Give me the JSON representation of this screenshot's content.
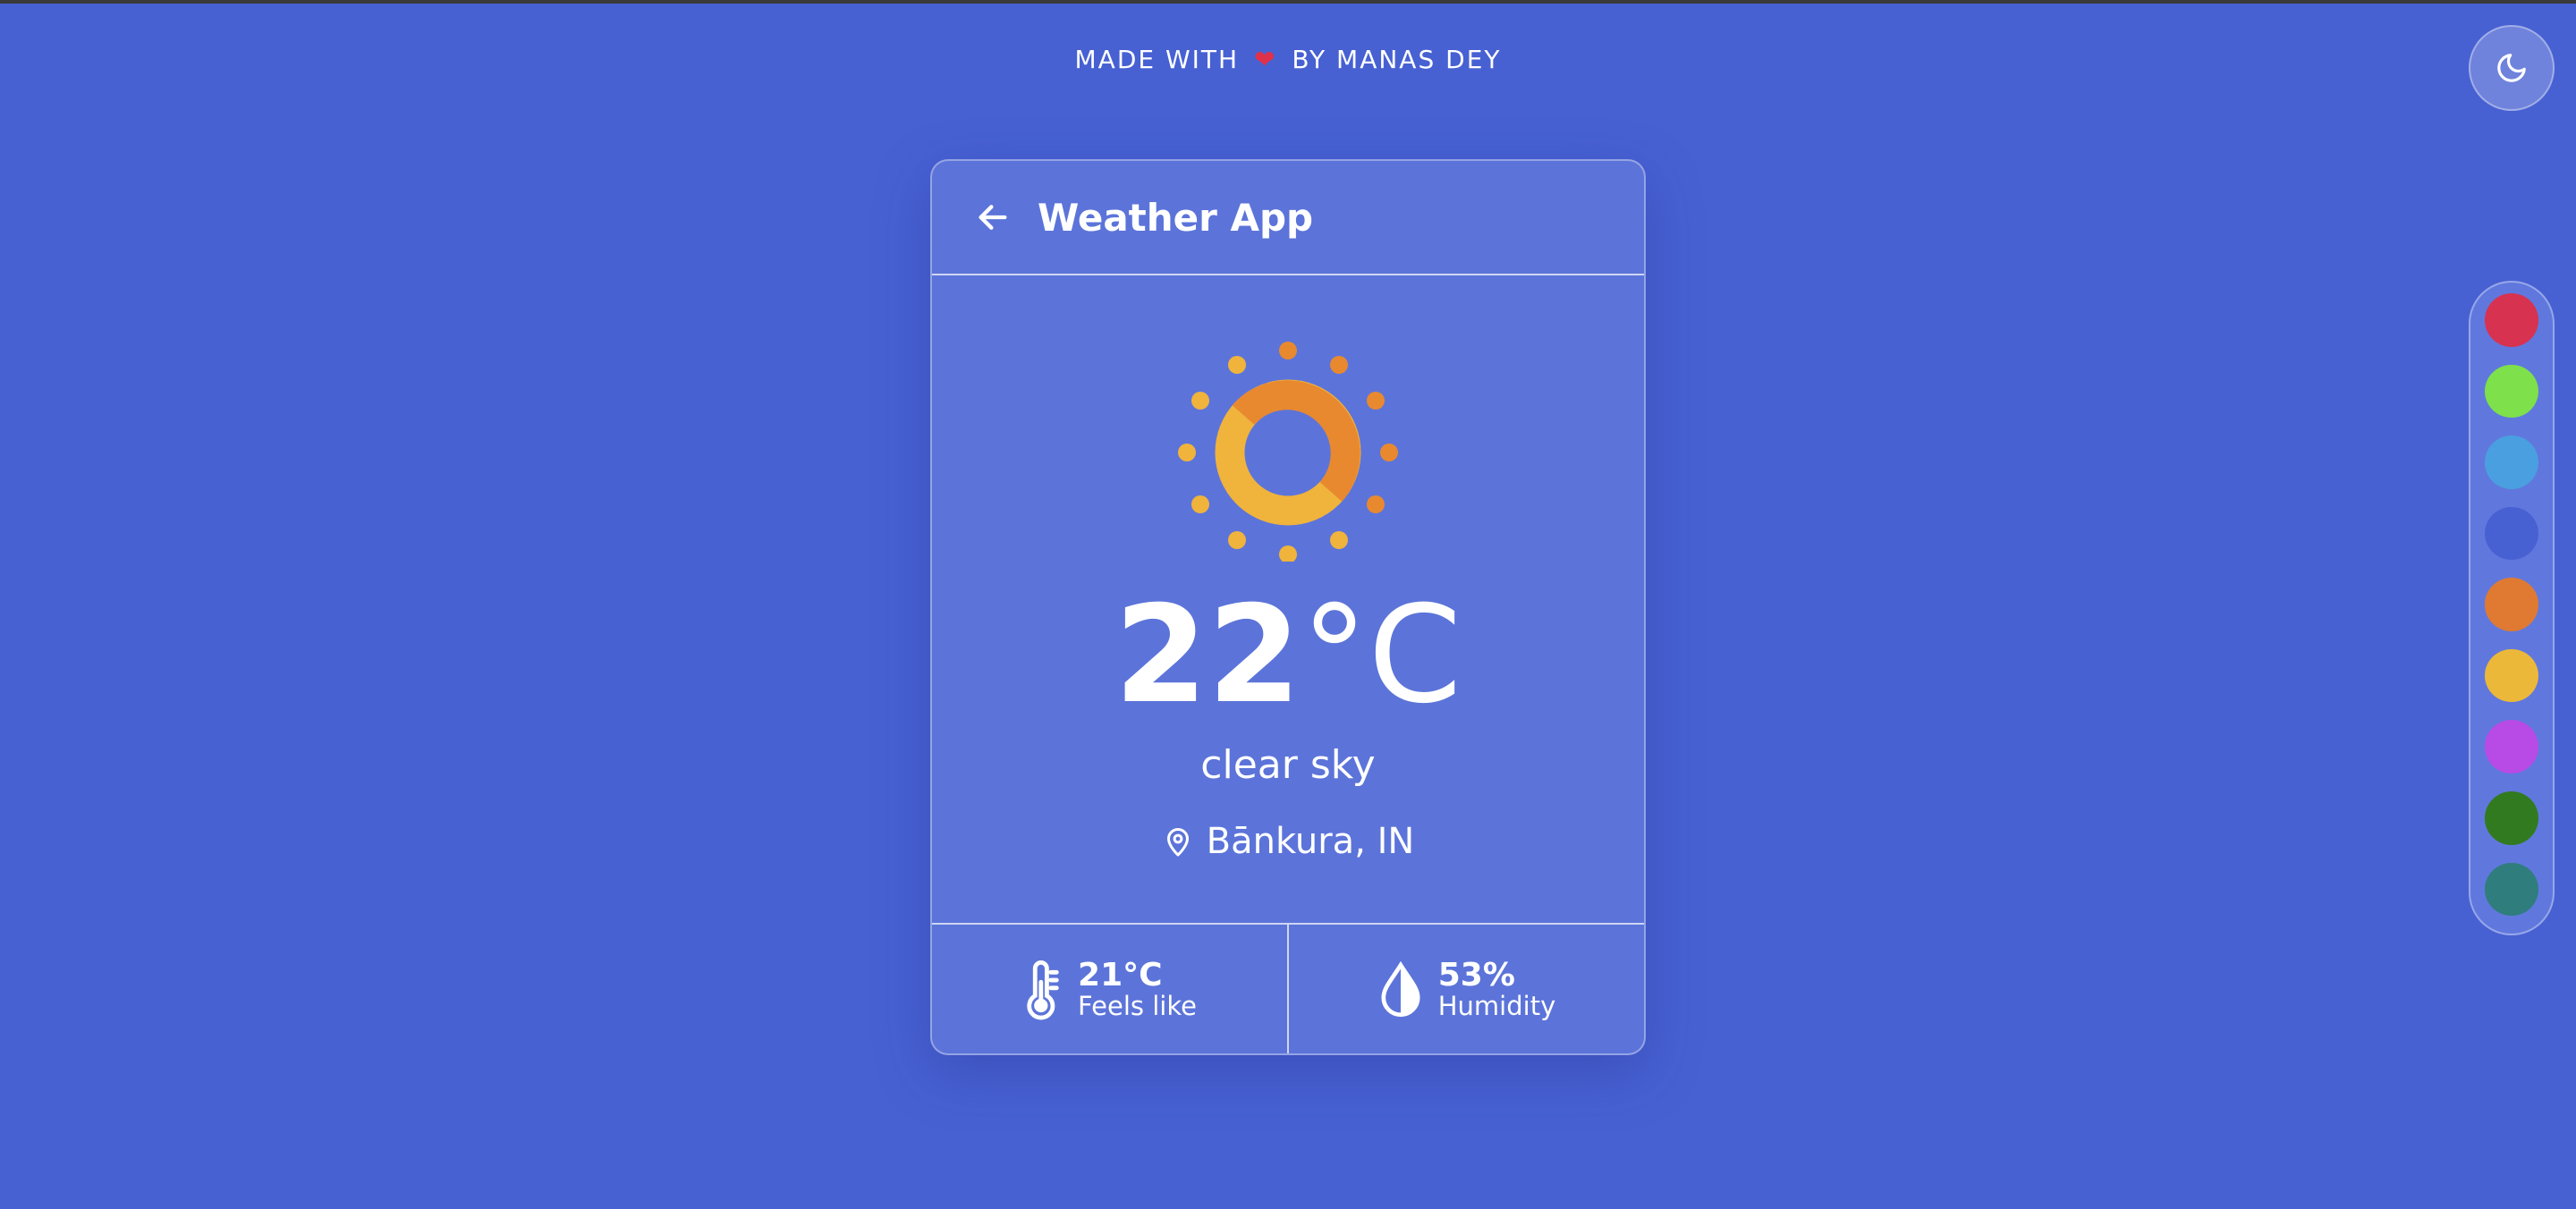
{
  "credit": {
    "prefix": "MADE WITH",
    "heart": "❤",
    "suffix": "BY MANAS DEY"
  },
  "theme_toggle": {
    "icon": "moon-icon"
  },
  "card": {
    "title": "Weather App",
    "back_icon": "arrow-left-icon",
    "weather_icon": "sun-icon",
    "temperature": "22",
    "unit": "°C",
    "description": "clear sky",
    "location": "Bānkura, IN",
    "feels_like": {
      "value": "21°C",
      "label": "Feels like",
      "icon": "thermometer-icon"
    },
    "humidity": {
      "value": "53%",
      "label": "Humidity",
      "icon": "droplet-icon"
    }
  },
  "palette": {
    "colors": [
      "#d7324f",
      "#7ee04a",
      "#4a9fe0",
      "#4761d3",
      "#e07a32",
      "#ecb83a",
      "#b84ae6",
      "#327a1f",
      "#2f7d7d"
    ]
  },
  "colors": {
    "background": "#4761d3",
    "card": "#5c74d9",
    "sun_orange": "#e8892f",
    "sun_yellow": "#f0b33c"
  }
}
